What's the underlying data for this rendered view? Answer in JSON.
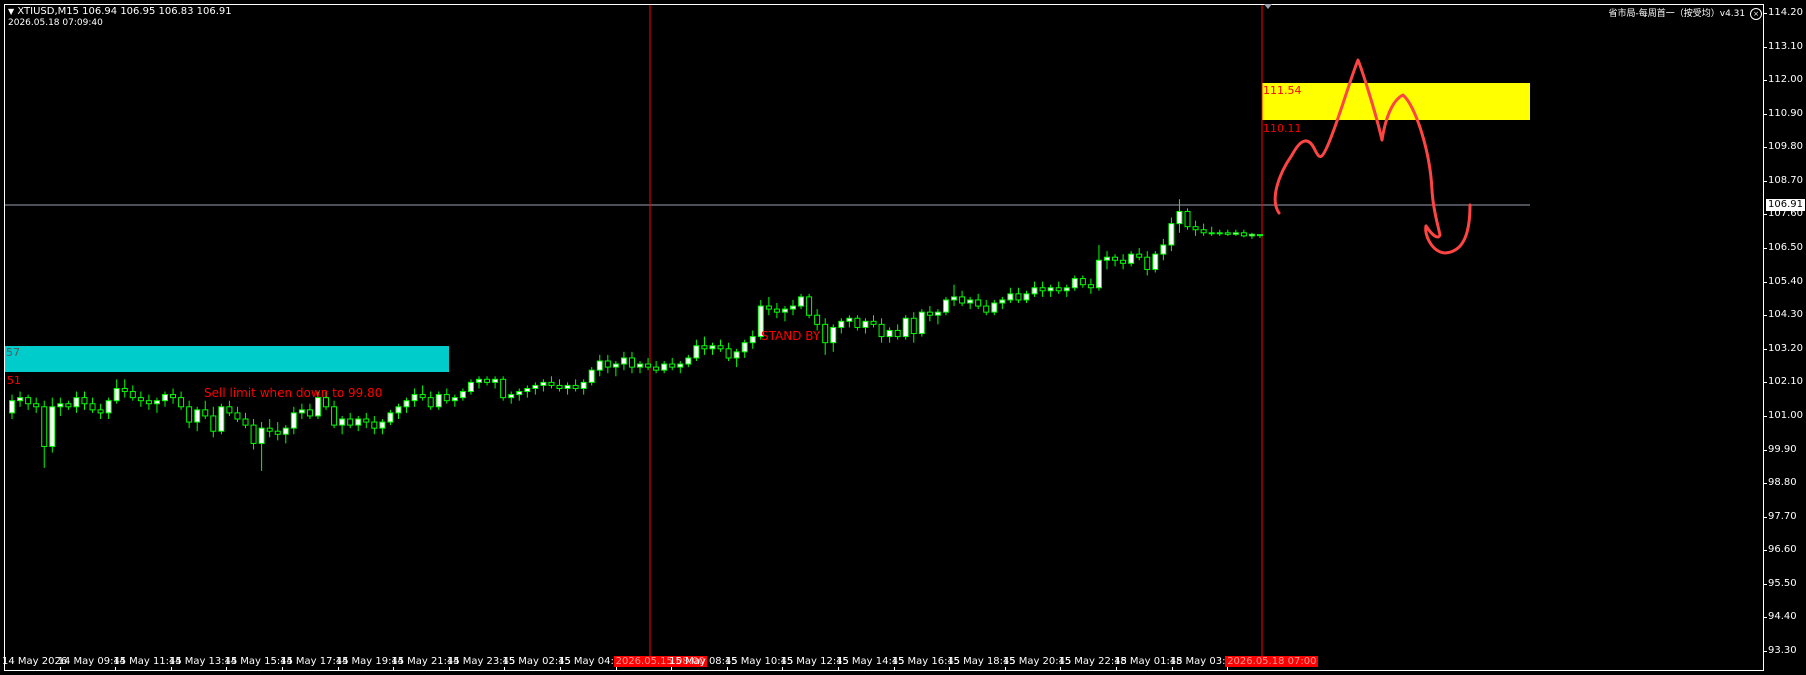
{
  "header": {
    "symbol_line": "XTIUSD,M15  106.94 106.95 106.83 106.91",
    "datetime": "2026.05.18 07:09:40",
    "indicator_title": "省市局-每周首一（按受均）v4.31"
  },
  "price_axis": {
    "labels": [
      "114.20",
      "113.10",
      "112.00",
      "110.90",
      "109.80",
      "108.70",
      "107.60",
      "106.50",
      "105.40",
      "104.30",
      "103.20",
      "102.10",
      "101.00",
      "99.90",
      "98.80",
      "97.70",
      "96.60",
      "95.50",
      "94.40",
      "93.30"
    ],
    "current_price": "106.91"
  },
  "time_axis": {
    "labels": [
      "14 May 2026",
      "14 May 09:45",
      "14 May 11:45",
      "14 May 13:45",
      "14 May 15:45",
      "14 May 17:45",
      "14 May 19:45",
      "14 May 21:45",
      "14 May 23:45",
      "15 May 02:45",
      "15 May 04:45",
      "2026.05.15 08:00",
      "15 May 08:45",
      "15 May 10:45",
      "15 May 12:45",
      "15 May 14:45",
      "15 May 16:45",
      "15 May 18:45",
      "15 May 20:45",
      "15 May 22:45",
      "18 May 01:45",
      "18 May 03:45",
      "2026.05.18 07:00"
    ],
    "highlighted": [
      "2026.05.15 08:00",
      "2026.05.18 07:00"
    ]
  },
  "zones": {
    "cyan": {
      "label_top": "57",
      "label_bottom": "51",
      "color": "#00cccc"
    },
    "yellow": {
      "label_top": "111.54",
      "label_bottom": "110.11",
      "color": "#ffff00"
    }
  },
  "annotations": {
    "sell_limit": "Sell limit when down to 99.80",
    "stand_by": "STAND BY"
  },
  "colors": {
    "candle_up": "#00ff00",
    "candle_body_up": "#ffffff",
    "vline": "#ff0000",
    "drawing": "#ff3333"
  },
  "chart_data": {
    "type": "candlestick",
    "ylim": [
      93.3,
      114.2
    ],
    "candles": [
      [
        101.1,
        101.7,
        100.9,
        101.5
      ],
      [
        101.5,
        101.8,
        101.3,
        101.6
      ],
      [
        101.6,
        101.7,
        101.2,
        101.4
      ],
      [
        101.4,
        101.6,
        101.1,
        101.3
      ],
      [
        101.3,
        101.5,
        99.3,
        100.0
      ],
      [
        100.0,
        101.6,
        99.8,
        101.3
      ],
      [
        101.3,
        101.6,
        101.0,
        101.4
      ],
      [
        101.4,
        101.5,
        101.2,
        101.3
      ],
      [
        101.3,
        101.8,
        101.1,
        101.6
      ],
      [
        101.6,
        101.8,
        101.2,
        101.4
      ],
      [
        101.4,
        101.6,
        101.1,
        101.2
      ],
      [
        101.2,
        101.4,
        100.9,
        101.1
      ],
      [
        101.1,
        101.6,
        100.9,
        101.5
      ],
      [
        101.5,
        102.2,
        101.4,
        101.9
      ],
      [
        101.9,
        102.2,
        101.6,
        101.8
      ],
      [
        101.8,
        102.0,
        101.5,
        101.6
      ],
      [
        101.6,
        101.8,
        101.3,
        101.5
      ],
      [
        101.5,
        101.7,
        101.2,
        101.4
      ],
      [
        101.4,
        101.6,
        101.1,
        101.5
      ],
      [
        101.5,
        101.8,
        101.3,
        101.7
      ],
      [
        101.7,
        101.9,
        101.4,
        101.6
      ],
      [
        101.6,
        101.8,
        101.2,
        101.3
      ],
      [
        101.3,
        101.5,
        100.6,
        100.8
      ],
      [
        100.8,
        101.3,
        100.5,
        101.2
      ],
      [
        101.2,
        101.5,
        100.9,
        101.0
      ],
      [
        101.0,
        101.3,
        100.3,
        100.5
      ],
      [
        100.5,
        101.4,
        100.4,
        101.3
      ],
      [
        101.3,
        101.5,
        101.0,
        101.1
      ],
      [
        101.1,
        101.3,
        100.8,
        100.9
      ],
      [
        100.9,
        101.1,
        100.6,
        100.7
      ],
      [
        100.7,
        100.9,
        99.9,
        100.1
      ],
      [
        100.1,
        100.8,
        99.2,
        100.6
      ],
      [
        100.6,
        100.9,
        100.3,
        100.5
      ],
      [
        100.5,
        100.8,
        100.2,
        100.4
      ],
      [
        100.4,
        100.7,
        100.1,
        100.6
      ],
      [
        100.6,
        101.3,
        100.4,
        101.1
      ],
      [
        101.1,
        101.4,
        100.9,
        101.2
      ],
      [
        101.2,
        101.4,
        100.9,
        101.0
      ],
      [
        101.0,
        101.8,
        100.9,
        101.6
      ],
      [
        101.6,
        101.8,
        101.2,
        101.3
      ],
      [
        101.3,
        101.5,
        100.6,
        100.7
      ],
      [
        100.7,
        101.0,
        100.4,
        100.9
      ],
      [
        100.9,
        101.1,
        100.6,
        100.7
      ],
      [
        100.7,
        101.0,
        100.5,
        100.9
      ],
      [
        100.9,
        101.1,
        100.6,
        100.8
      ],
      [
        100.8,
        101.0,
        100.4,
        100.6
      ],
      [
        100.6,
        100.9,
        100.4,
        100.8
      ],
      [
        100.8,
        101.2,
        100.7,
        101.1
      ],
      [
        101.1,
        101.4,
        100.9,
        101.3
      ],
      [
        101.3,
        101.6,
        101.1,
        101.5
      ],
      [
        101.5,
        101.9,
        101.3,
        101.7
      ],
      [
        101.7,
        102.0,
        101.5,
        101.6
      ],
      [
        101.6,
        101.8,
        101.2,
        101.3
      ],
      [
        101.3,
        101.8,
        101.2,
        101.7
      ],
      [
        101.7,
        101.9,
        101.4,
        101.5
      ],
      [
        101.5,
        101.7,
        101.3,
        101.6
      ],
      [
        101.6,
        101.9,
        101.5,
        101.8
      ],
      [
        101.8,
        102.2,
        101.7,
        102.1
      ],
      [
        102.1,
        102.3,
        101.9,
        102.2
      ],
      [
        102.2,
        102.3,
        102.0,
        102.1
      ],
      [
        102.1,
        102.3,
        101.9,
        102.2
      ],
      [
        102.2,
        102.3,
        101.5,
        101.6
      ],
      [
        101.6,
        101.8,
        101.4,
        101.7
      ],
      [
        101.7,
        101.9,
        101.5,
        101.8
      ],
      [
        101.8,
        102.0,
        101.6,
        101.9
      ],
      [
        101.9,
        102.1,
        101.7,
        102.0
      ],
      [
        102.0,
        102.2,
        101.8,
        102.1
      ],
      [
        102.1,
        102.3,
        101.9,
        102.0
      ],
      [
        102.0,
        102.2,
        101.8,
        101.9
      ],
      [
        101.9,
        102.1,
        101.7,
        102.0
      ],
      [
        102.0,
        102.2,
        101.8,
        101.9
      ],
      [
        101.9,
        102.2,
        101.7,
        102.1
      ],
      [
        102.1,
        102.6,
        102.0,
        102.5
      ],
      [
        102.5,
        103.0,
        102.3,
        102.8
      ],
      [
        102.8,
        103.0,
        102.4,
        102.6
      ],
      [
        102.6,
        102.8,
        102.3,
        102.7
      ],
      [
        102.7,
        103.1,
        102.5,
        102.9
      ],
      [
        102.9,
        103.1,
        102.4,
        102.6
      ],
      [
        102.6,
        102.8,
        102.4,
        102.7
      ],
      [
        102.7,
        102.9,
        102.5,
        102.6
      ],
      [
        102.6,
        102.8,
        102.4,
        102.5
      ],
      [
        102.5,
        102.8,
        102.4,
        102.7
      ],
      [
        102.7,
        102.9,
        102.5,
        102.6
      ],
      [
        102.6,
        102.8,
        102.4,
        102.7
      ],
      [
        102.7,
        103.0,
        102.6,
        102.9
      ],
      [
        102.9,
        103.5,
        102.8,
        103.3
      ],
      [
        103.3,
        103.6,
        103.0,
        103.2
      ],
      [
        103.2,
        103.4,
        103.0,
        103.3
      ],
      [
        103.3,
        103.5,
        103.1,
        103.2
      ],
      [
        103.2,
        103.4,
        102.8,
        102.9
      ],
      [
        102.9,
        103.2,
        102.6,
        103.1
      ],
      [
        103.1,
        103.5,
        102.9,
        103.4
      ],
      [
        103.4,
        103.8,
        103.2,
        103.6
      ],
      [
        103.6,
        104.8,
        103.5,
        104.6
      ],
      [
        104.6,
        104.9,
        104.3,
        104.5
      ],
      [
        104.5,
        104.7,
        104.2,
        104.4
      ],
      [
        104.4,
        104.6,
        104.1,
        104.5
      ],
      [
        104.5,
        104.8,
        104.3,
        104.6
      ],
      [
        104.6,
        105.0,
        104.5,
        104.9
      ],
      [
        104.9,
        105.0,
        104.2,
        104.3
      ],
      [
        104.3,
        104.5,
        103.8,
        104.0
      ],
      [
        104.0,
        104.2,
        103.0,
        103.4
      ],
      [
        103.4,
        104.0,
        103.1,
        103.9
      ],
      [
        103.9,
        104.2,
        103.7,
        104.1
      ],
      [
        104.1,
        104.3,
        103.9,
        104.2
      ],
      [
        104.2,
        104.3,
        103.8,
        103.9
      ],
      [
        103.9,
        104.2,
        103.7,
        104.1
      ],
      [
        104.1,
        104.3,
        103.9,
        104.0
      ],
      [
        104.0,
        104.2,
        103.4,
        103.6
      ],
      [
        103.6,
        103.9,
        103.4,
        103.8
      ],
      [
        103.8,
        104.0,
        103.5,
        103.6
      ],
      [
        103.6,
        104.3,
        103.5,
        104.2
      ],
      [
        104.2,
        104.4,
        103.4,
        103.7
      ],
      [
        103.7,
        104.5,
        103.6,
        104.4
      ],
      [
        104.4,
        104.6,
        104.1,
        104.3
      ],
      [
        104.3,
        104.5,
        104.0,
        104.4
      ],
      [
        104.4,
        104.9,
        104.3,
        104.8
      ],
      [
        104.8,
        105.3,
        104.6,
        104.9
      ],
      [
        104.9,
        105.1,
        104.6,
        104.7
      ],
      [
        104.7,
        104.9,
        104.5,
        104.8
      ],
      [
        104.8,
        105.0,
        104.5,
        104.6
      ],
      [
        104.6,
        104.8,
        104.3,
        104.4
      ],
      [
        104.4,
        104.8,
        104.3,
        104.7
      ],
      [
        104.7,
        104.9,
        104.5,
        104.8
      ],
      [
        104.8,
        105.2,
        104.7,
        105.0
      ],
      [
        105.0,
        105.2,
        104.7,
        104.8
      ],
      [
        104.8,
        105.1,
        104.7,
        105.0
      ],
      [
        105.0,
        105.4,
        104.9,
        105.2
      ],
      [
        105.2,
        105.4,
        104.9,
        105.1
      ],
      [
        105.1,
        105.3,
        104.9,
        105.2
      ],
      [
        105.2,
        105.4,
        105.0,
        105.1
      ],
      [
        105.1,
        105.3,
        104.9,
        105.2
      ],
      [
        105.2,
        105.6,
        105.1,
        105.5
      ],
      [
        105.5,
        105.6,
        105.2,
        105.3
      ],
      [
        105.3,
        105.5,
        105.0,
        105.2
      ],
      [
        105.2,
        106.6,
        105.1,
        106.1
      ],
      [
        106.1,
        106.4,
        105.8,
        106.2
      ],
      [
        106.2,
        106.3,
        105.9,
        106.1
      ],
      [
        106.1,
        106.3,
        105.8,
        106.0
      ],
      [
        106.0,
        106.4,
        105.9,
        106.3
      ],
      [
        106.3,
        106.5,
        106.1,
        106.2
      ],
      [
        106.2,
        106.4,
        105.6,
        105.8
      ],
      [
        105.8,
        106.4,
        105.7,
        106.3
      ],
      [
        106.3,
        106.8,
        106.1,
        106.6
      ],
      [
        106.6,
        107.5,
        106.4,
        107.3
      ],
      [
        107.3,
        108.1,
        107.0,
        107.7
      ],
      [
        107.7,
        107.8,
        107.1,
        107.2
      ],
      [
        107.2,
        107.4,
        106.9,
        107.1
      ],
      [
        107.1,
        107.3,
        106.9,
        107.0
      ],
      [
        107.0,
        107.2,
        106.9,
        107.0
      ],
      [
        107.0,
        107.1,
        106.9,
        107.0
      ],
      [
        107.0,
        107.1,
        106.9,
        106.95
      ],
      [
        106.95,
        107.1,
        106.9,
        107.0
      ],
      [
        107.0,
        107.1,
        106.85,
        106.9
      ],
      [
        106.9,
        107.0,
        106.8,
        106.95
      ],
      [
        106.94,
        106.95,
        106.83,
        106.91
      ]
    ]
  }
}
